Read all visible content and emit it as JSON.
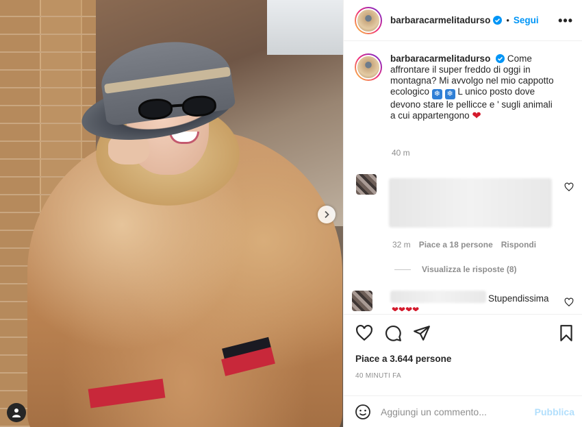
{
  "post": {
    "username": "barbaracarmelitadurso",
    "follow_label": "Segui",
    "more_label": "•••",
    "separator": "•",
    "caption_line_1": "Come affrontare il super freddo di oggi in montagna? Mi avvolgo nel mio cappotto ecologico ",
    "caption_line_2": " L unico posto dove devono stare le pellicce e ' sugli animali a cui appartengono ",
    "caption_time": "40 m",
    "likes": "Piace a 3.644 persone",
    "post_time": "40 MINUTI FA"
  },
  "comments": [
    {
      "time": "32 m",
      "likes": "Piace a 18 persone",
      "reply_label": "Rispondi",
      "view_replies": "Visualizza le risposte (8)"
    },
    {
      "text": "Stupendissima"
    }
  ],
  "composer": {
    "placeholder": "Aggiungi un commento...",
    "publish_label": "Pubblica"
  },
  "colors": {
    "accent": "#0095f6",
    "publish_disabled": "#b2dffc",
    "heart": "#d41a2c"
  },
  "icons": {
    "verified": "verified-badge-icon",
    "like": "heart-outline-icon",
    "comment": "comment-bubble-icon",
    "share": "paper-plane-icon",
    "save": "bookmark-icon",
    "emoji": "smiley-icon",
    "next": "chevron-right-icon",
    "tags": "tagged-user-icon"
  }
}
